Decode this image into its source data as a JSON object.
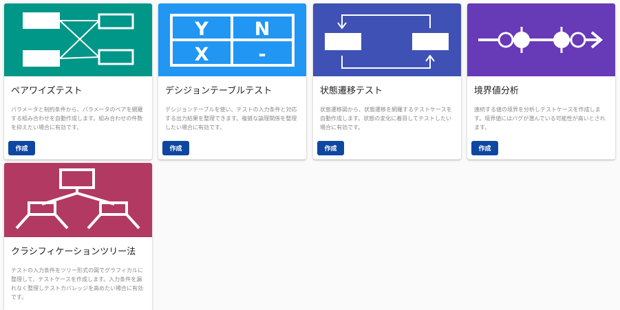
{
  "cards": [
    {
      "title": "ペアワイズテスト",
      "description": "パラメータと制約条件から、パラメータのペアを網羅する組み合わせを自動作成します。組み合わせの件数を抑えたい場合に有効です。",
      "button_label": "作成",
      "color": "#009688",
      "icon": "pairwise-icon"
    },
    {
      "title": "デシジョンテーブルテスト",
      "description": "デシジョンテーブルを使い、テストの入力条件と対応する出力結果を整理できます。複雑な論理関係を整理したい場合に有効です。",
      "button_label": "作成",
      "color": "#2196f3",
      "icon": "decision-table-icon",
      "icon_text": [
        "Y",
        "N",
        "X",
        "-"
      ]
    },
    {
      "title": "状態遷移テスト",
      "description": "状態遷移図から、状態遷移を網羅するテストケースを自動作成します。状態の変化に着目してテストしたい場合に有効です。",
      "button_label": "作成",
      "color": "#3f51b5",
      "icon": "state-transition-icon"
    },
    {
      "title": "境界値分析",
      "description": "連続する値の境界を分析しテストケースを作成します。境界値にはバグが潜んでいる可能性が高いとされます。",
      "button_label": "作成",
      "color": "#673ab7",
      "icon": "boundary-value-icon"
    },
    {
      "title": "クラシフィケーションツリー法",
      "description": "テストの入力条件をツリー形式の図でグラフィカルに整理して、テストケースを作成します。入力条件を漏れなく整理しテストカバレッジを高めたい場合に有効です。",
      "color": "#b23a62",
      "icon": "classification-tree-icon"
    }
  ]
}
